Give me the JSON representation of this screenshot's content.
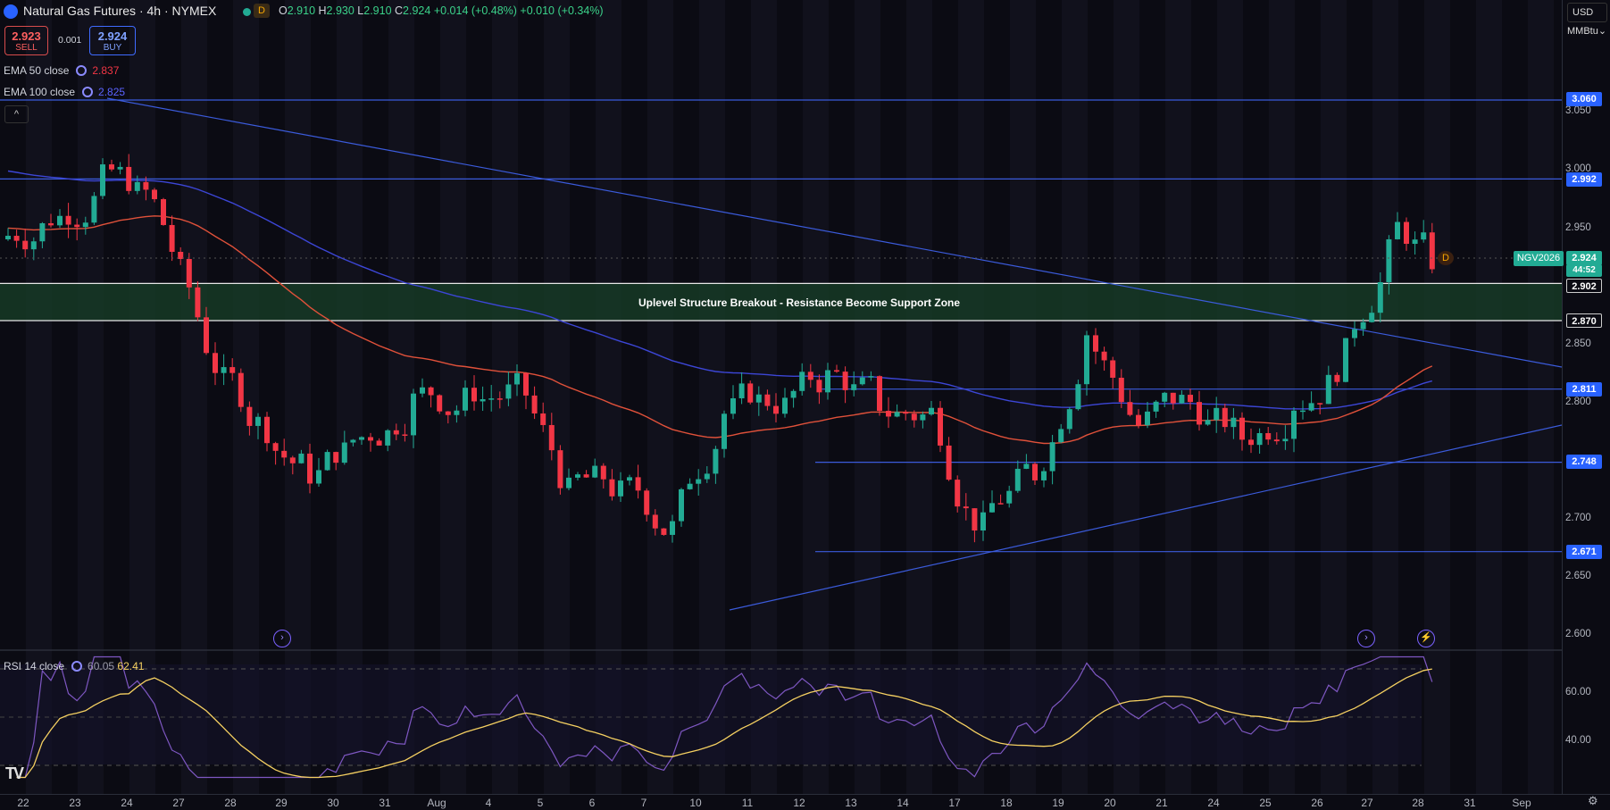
{
  "header": {
    "title": "Natural Gas Futures · 4h · NYMEX",
    "timeframe_badge": "D",
    "ohlc": {
      "open_label": "O",
      "open": "2.910",
      "high_label": "H",
      "high": "2.930",
      "low_label": "L",
      "low": "2.910",
      "close_label": "C",
      "close": "2.924",
      "change": "+0.014 (+0.48%)",
      "change2": "+0.010 (+0.34%)"
    }
  },
  "trade": {
    "sell_price": "2.923",
    "sell_label": "SELL",
    "spread": "0.001",
    "buy_price": "2.924",
    "buy_label": "BUY"
  },
  "indicators": {
    "ema50_label": "EMA 50 close",
    "ema50_value": "2.837",
    "ema100_label": "EMA 100 close",
    "ema100_value": "2.825",
    "rsi_label": "RSI 14 close",
    "rsi_value1": "60.05",
    "rsi_value2": "62.41",
    "collapse": "^"
  },
  "axis": {
    "currency": "USD",
    "unit": "MMBtu",
    "price_ticks": [
      "3.050",
      "3.000",
      "2.950",
      "2.850",
      "2.800",
      "2.700",
      "2.650",
      "2.600"
    ],
    "rsi_ticks": [
      "60.00",
      "40.00"
    ],
    "time_ticks": [
      "22",
      "23",
      "24",
      "27",
      "28",
      "29",
      "30",
      "31",
      "Aug",
      "4",
      "5",
      "6",
      "7",
      "10",
      "11",
      "12",
      "13",
      "14",
      "17",
      "18",
      "19",
      "20",
      "21",
      "24",
      "25",
      "26",
      "27",
      "28",
      "31",
      "Sep"
    ]
  },
  "levels": {
    "l1": "3.060",
    "l2": "2.992",
    "l3": "2.902",
    "l4": "2.870",
    "l5": "2.811",
    "l6": "2.748",
    "l7": "2.671"
  },
  "last_price": {
    "symbol": "NGV2026",
    "price": "2.924",
    "countdown": "44:52"
  },
  "zone_label": "Uplevel Structure Breakout - Resistance Become Support Zone",
  "colors": {
    "up": "#22ab94",
    "down": "#f23645",
    "ema50": "#e0513a",
    "ema100": "#3c46d6",
    "level": "#3b5bdb",
    "rsi": "#7e57c2",
    "rsi_ma": "#f5d061",
    "zone": "#163a26"
  },
  "icons": [
    "tv-logo-icon",
    "settings-gear-icon",
    "dividend-icon",
    "lightning-icon"
  ],
  "branding": "TV",
  "chart_data": {
    "type": "candlestick",
    "x": [
      "22",
      "23",
      "24",
      "27",
      "28",
      "29",
      "30",
      "31",
      "Aug",
      "4",
      "5",
      "6",
      "7",
      "10",
      "11",
      "12",
      "13",
      "14",
      "17",
      "18",
      "19",
      "20",
      "21",
      "24",
      "25",
      "26",
      "27",
      "28"
    ],
    "close_by_day": [
      2.96,
      2.99,
      2.97,
      2.85,
      2.78,
      2.74,
      2.77,
      2.8,
      2.8,
      2.81,
      2.72,
      2.72,
      2.69,
      2.79,
      2.8,
      2.82,
      2.8,
      2.79,
      2.69,
      2.74,
      2.86,
      2.78,
      2.8,
      2.77,
      2.8,
      2.84,
      2.95,
      2.924
    ],
    "ylim": [
      2.58,
      3.09
    ],
    "rsi_ylim": [
      20,
      80
    ]
  }
}
